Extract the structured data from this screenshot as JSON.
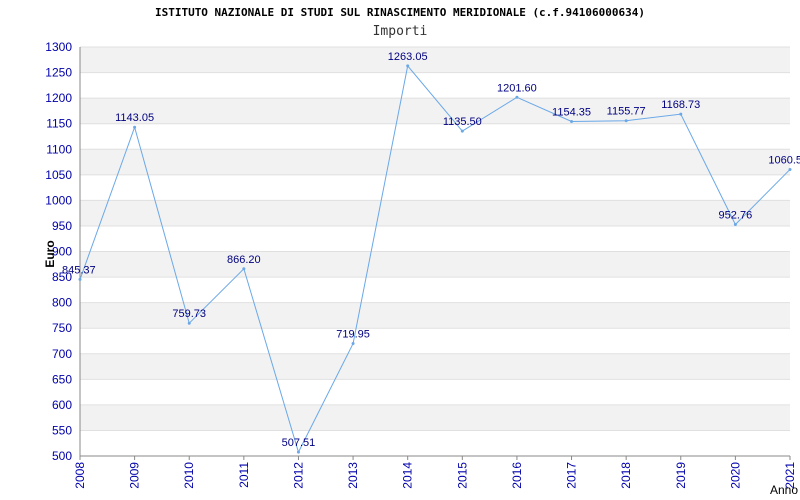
{
  "chart_data": {
    "type": "line",
    "title": "ISTITUTO NAZIONALE DI STUDI SUL RINASCIMENTO MERIDIONALE (c.f.94106000634)",
    "subtitle": "Importi",
    "xlabel": "Anno",
    "ylabel": "Euro",
    "ylim": [
      500,
      1300
    ],
    "ytick_step": 50,
    "grid": "horizontal alternating bands",
    "x": [
      "2008",
      "2009",
      "2010",
      "2011",
      "2012",
      "2013",
      "2014",
      "2015",
      "2016",
      "2017",
      "2018",
      "2019",
      "2020",
      "2021"
    ],
    "values": [
      845.37,
      1143.05,
      759.73,
      866.2,
      507.51,
      719.95,
      1263.05,
      1135.5,
      1201.6,
      1154.35,
      1155.77,
      1168.73,
      952.76,
      1060.5
    ],
    "data_labels": [
      "845.37",
      "1143.05",
      "759.73",
      "866.20",
      "507.51",
      "719.95",
      "1263.05",
      "1135.50",
      "1201.60",
      "1154.35",
      "1155.77",
      "1168.73",
      "952.76",
      "1060.5"
    ],
    "colors": {
      "line": "#6aa8e8",
      "tick_label": "#0000aa",
      "data_label": "#000080",
      "band": "#f2f2f2",
      "axis": "#888888"
    }
  }
}
